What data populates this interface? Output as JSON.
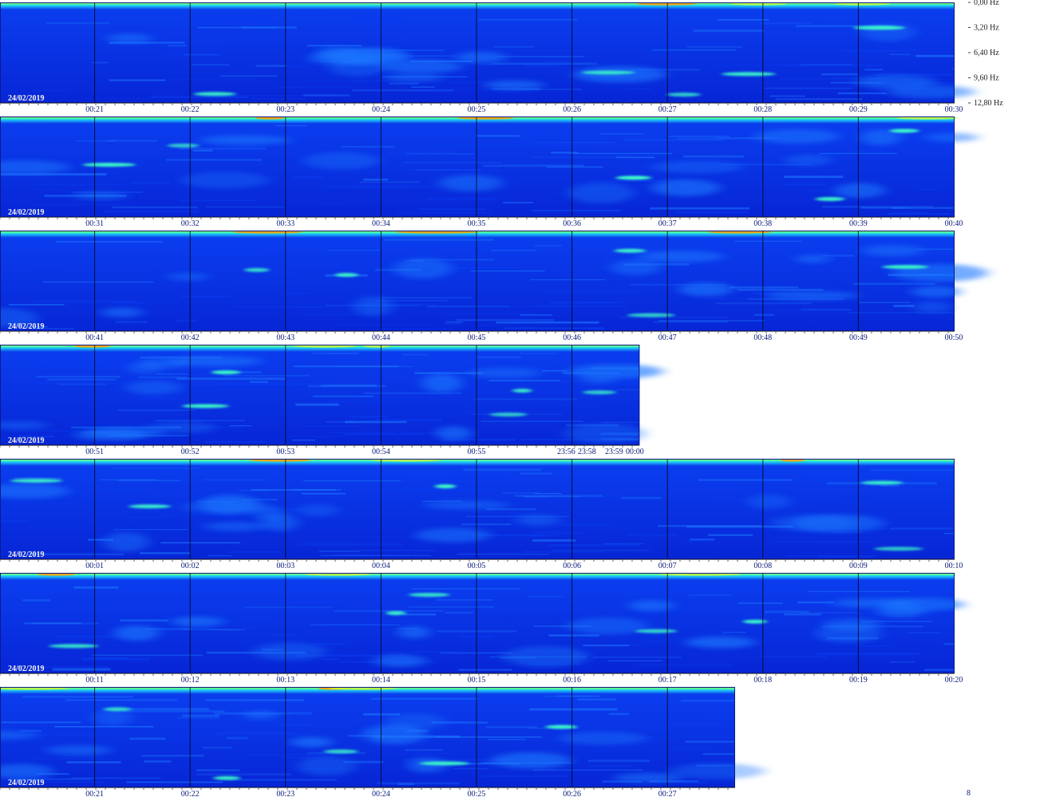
{
  "chart_data": {
    "type": "heatmap",
    "kind": "spectrogram",
    "colormap": [
      "#0020d8",
      "#0a3cf0",
      "#1e78ff",
      "#19c8ff",
      "#3cffc8",
      "#c8ff3c",
      "#ff9a00",
      "#d01010"
    ],
    "frequency_axis": {
      "labels": [
        "0,00 Hz",
        "3,20 Hz",
        "6,40 Hz",
        "9,60 Hz",
        "12,80 Hz"
      ],
      "values_hz": [
        0.0,
        3.2,
        6.4,
        9.6,
        12.8
      ],
      "ylim_hz": [
        0,
        12.8
      ],
      "direction": "top-to-bottom"
    },
    "rows": [
      {
        "date": "24/02/2019",
        "ticks": [
          "00:21",
          "00:22",
          "00:23",
          "00:24",
          "00:25",
          "00:26",
          "00:27",
          "00:28",
          "00:29",
          "00:30"
        ],
        "extra_ticks": [],
        "duration_min": 10
      },
      {
        "date": "24/02/2019",
        "ticks": [
          "00:31",
          "00:32",
          "00:33",
          "00:34",
          "00:35",
          "00:36",
          "00:37",
          "00:38",
          "00:39",
          "00:40"
        ],
        "extra_ticks": [],
        "duration_min": 10
      },
      {
        "date": "24/02/2019",
        "ticks": [
          "00:41",
          "00:42",
          "00:43",
          "00:44",
          "00:45",
          "00:46",
          "00:47",
          "00:48",
          "00:49",
          "00:50"
        ],
        "extra_ticks": [],
        "duration_min": 10
      },
      {
        "date": "24/02/2019",
        "ticks": [
          "00:51",
          "00:52",
          "00:53",
          "00:54",
          "00:55"
        ],
        "extra_ticks": [
          "23:56",
          "23:58",
          "23:59",
          "00:00"
        ],
        "duration_min": 6.7
      },
      {
        "date": "24/02/2019",
        "ticks": [
          "00:01",
          "00:02",
          "00:03",
          "00:04",
          "00:05",
          "00:06",
          "00:07",
          "00:08",
          "00:09",
          "00:10"
        ],
        "extra_ticks": [],
        "duration_min": 10
      },
      {
        "date": "24/02/2019",
        "ticks": [
          "00:11",
          "00:12",
          "00:13",
          "00:14",
          "00:15",
          "00:16",
          "00:17",
          "00:18",
          "00:19",
          "00:20"
        ],
        "extra_ticks": [],
        "duration_min": 10
      },
      {
        "date": "24/02/2019",
        "ticks": [
          "00:21",
          "00:22",
          "00:23",
          "00:24",
          "00:25",
          "00:26",
          "00:27"
        ],
        "extra_ticks": [],
        "duration_min": 7.7
      }
    ],
    "corner_mark": "8"
  }
}
